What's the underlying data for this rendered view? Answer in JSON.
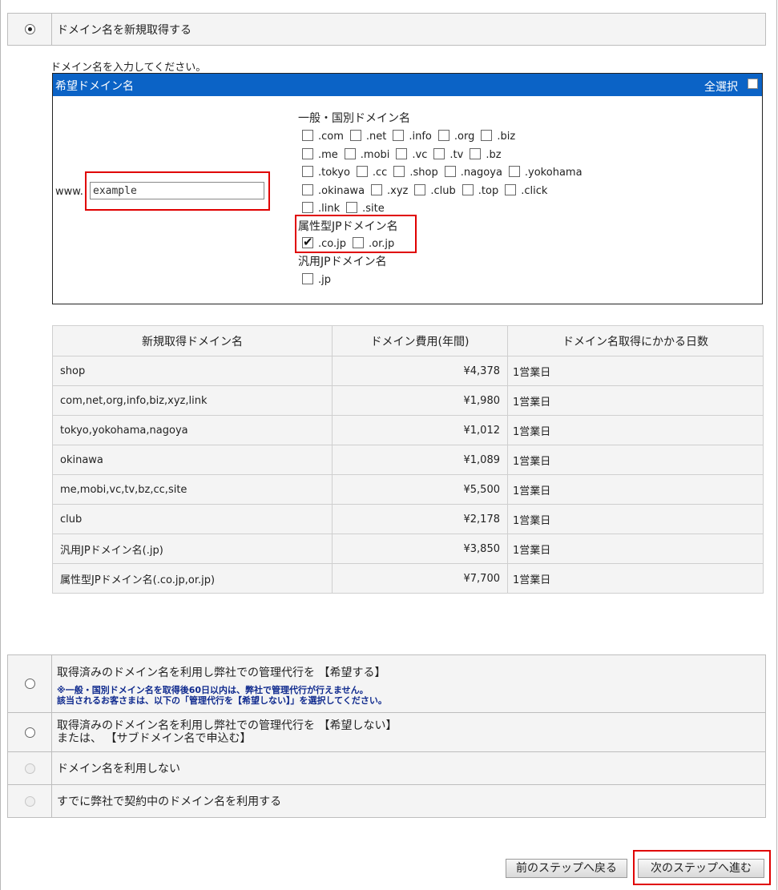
{
  "top_option": {
    "label": "ドメイン名を新規取得する",
    "checked": true
  },
  "instruction": "ドメイン名を入力してください。",
  "domain_box": {
    "header_title": "希望ドメイン名",
    "select_all": "全選択",
    "www_prefix": "www.",
    "input_value": "example"
  },
  "categories": {
    "general": {
      "title": "一般・国別ドメイン名",
      "rows": [
        [
          ".com",
          ".net",
          ".info",
          ".org",
          ".biz"
        ],
        [
          ".me",
          ".mobi",
          ".vc",
          ".tv",
          ".bz"
        ],
        [
          ".tokyo",
          ".cc",
          ".shop",
          ".nagoya",
          ".yokohama"
        ],
        [
          ".okinawa",
          ".xyz",
          ".club",
          ".top",
          ".click"
        ],
        [
          ".link",
          ".site"
        ]
      ]
    },
    "attribute_jp": {
      "title": "属性型JPドメイン名",
      "items": [
        ".co.jp",
        ".or.jp"
      ],
      "checked": [
        ".co.jp"
      ]
    },
    "general_jp": {
      "title": "汎用JPドメイン名",
      "items": [
        ".jp"
      ]
    }
  },
  "price_table": {
    "headers": [
      "新規取得ドメイン名",
      "ドメイン費用(年間)",
      "ドメイン名取得にかかる日数"
    ],
    "rows": [
      [
        "shop",
        "¥4,378",
        "1営業日"
      ],
      [
        "com,net,org,info,biz,xyz,link",
        "¥1,980",
        "1営業日"
      ],
      [
        "tokyo,yokohama,nagoya",
        "¥1,012",
        "1営業日"
      ],
      [
        "okinawa",
        "¥1,089",
        "1営業日"
      ],
      [
        "me,mobi,vc,tv,bz,cc,site",
        "¥5,500",
        "1営業日"
      ],
      [
        "club",
        "¥2,178",
        "1営業日"
      ],
      [
        "汎用JPドメイン名(.jp)",
        "¥3,850",
        "1営業日"
      ],
      [
        "属性型JPドメイン名(.co.jp,or.jp)",
        "¥7,700",
        "1営業日"
      ]
    ]
  },
  "other_options": {
    "opt1_label": "取得済みのドメイン名を利用し弊社での管理代行を 【希望する】",
    "opt1_note_1": "※一般・国別ドメイン名を取得後60日以内は、弊社で管理代行が行えません。",
    "opt1_note_2": "該当されるお客さまは、以下の「管理代行を【希望しない】」を選択してください。",
    "opt2_label_1": "取得済みのドメイン名を利用し弊社での管理代行を 【希望しない】",
    "opt2_label_2": "または、 【サブドメイン名で申込む】",
    "opt3_label": "ドメイン名を利用しない",
    "opt4_label": "すでに弊社で契約中のドメイン名を利用する"
  },
  "buttons": {
    "prev": "前のステップへ戻る",
    "next": "次のステップへ進む"
  },
  "colors": {
    "header_blue": "#0b63c6",
    "highlight_red": "#e00000",
    "note_navy": "#0f2a8e"
  }
}
